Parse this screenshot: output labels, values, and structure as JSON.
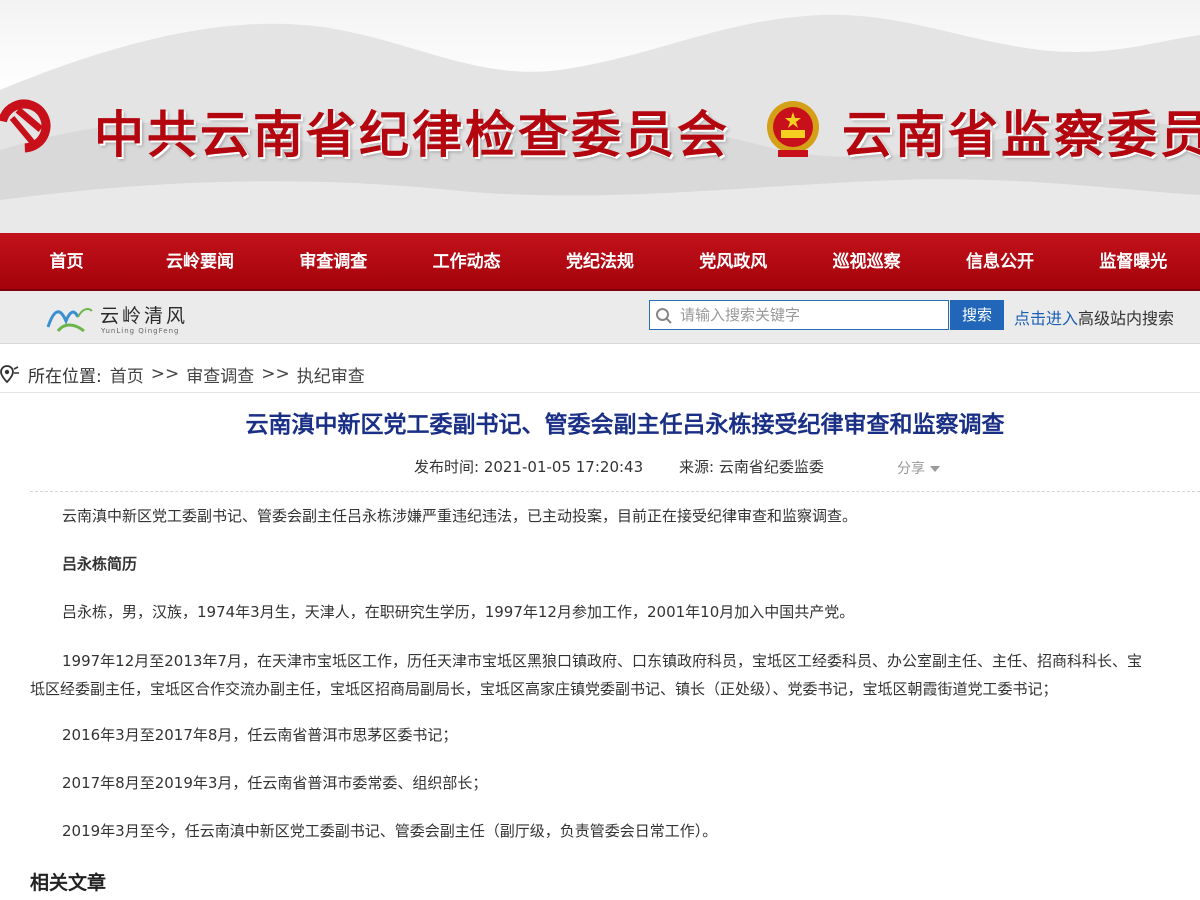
{
  "banner": {
    "title_left": "中共云南省纪律检查委员会",
    "title_right": "云南省监察委员会"
  },
  "nav": {
    "items": [
      "首页",
      "云岭要闻",
      "审查调查",
      "工作动态",
      "党纪法规",
      "党风政风",
      "巡视巡察",
      "信息公开",
      "监督曝光"
    ]
  },
  "subbar": {
    "logo_text": "云岭清风",
    "logo_sub": "YunLing QingFeng",
    "search_placeholder": "请输入搜索关键字",
    "search_button": "搜索",
    "advanced_link": "点击进入",
    "advanced_text": "高级站内搜索"
  },
  "breadcrumb": {
    "label": "所在位置:",
    "items": [
      "首页",
      "审查调查",
      "执纪审查"
    ],
    "separator": ">>"
  },
  "article": {
    "title": "云南滇中新区党工委副书记、管委会副主任吕永栋接受纪律审查和监察调查",
    "publish_label": "发布时间: 2021-01-05 17:20:43",
    "source_label": "来源: 云南省纪委监委",
    "share": "分享",
    "paragraphs": [
      "云南滇中新区党工委副书记、管委会副主任吕永栋涉嫌严重违纪违法，已主动投案，目前正在接受纪律审查和监察调查。",
      "吕永栋简历",
      "吕永栋，男，汉族，1974年3月生，天津人，在职研究生学历，1997年12月参加工作，2001年10月加入中国共产党。",
      "1997年12月至2013年7月，在天津市宝坻区工作，历任天津市宝坻区黑狼口镇政府、口东镇政府科员，宝坻区工经委科员、办公室副主任、主任、招商科科长、宝",
      "坻区经委副主任，宝坻区合作交流办副主任，宝坻区招商局副局长，宝坻区高家庄镇党委副书记、镇长（正处级）、党委书记，宝坻区朝霞街道党工委书记；",
      "2016年3月至2017年8月，任云南省普洱市思茅区委书记；",
      "2017年8月至2019年3月，任云南省普洱市委常委、组织部长；",
      "2019年3月至今，任云南滇中新区党工委副书记、管委会副主任（副厅级，负责管委会日常工作）。"
    ],
    "related_heading": "相关文章"
  },
  "colors": {
    "nav_red": "#b3060f",
    "title_blue": "#1a2f86",
    "search_blue": "#2166b8",
    "link_blue": "#1b5fb5"
  }
}
